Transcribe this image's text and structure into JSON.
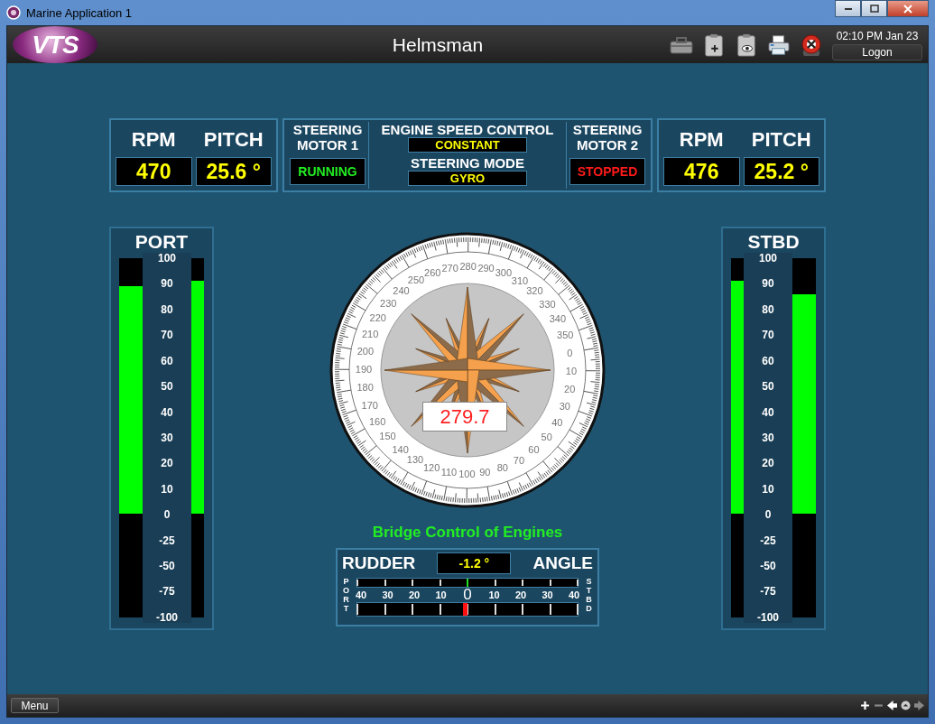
{
  "window": {
    "title": "Marine Application 1"
  },
  "header": {
    "logo": "VTS",
    "title": "Helmsman",
    "clock": "02:10 PM Jan 23",
    "logon_button": "Logon"
  },
  "top_panel": {
    "port_engine": {
      "rpm_label": "RPM",
      "pitch_label": "PITCH",
      "rpm": "470",
      "pitch": "25.6 °"
    },
    "steering_motors": [
      {
        "label": "STEERING MOTOR 1",
        "status": "RUNNING",
        "running": true
      },
      {
        "label": "STEERING MOTOR 2",
        "status": "STOPPED",
        "running": false
      }
    ],
    "engine_speed_control": {
      "label": "ENGINE SPEED CONTROL",
      "value": "CONSTANT"
    },
    "steering_mode": {
      "label": "STEERING MODE",
      "value": "GYRO"
    },
    "stbd_engine": {
      "rpm_label": "RPM",
      "pitch_label": "PITCH",
      "rpm": "476",
      "pitch": "25.2 °"
    }
  },
  "gauges": [
    {
      "title": "PORT",
      "bars": [
        {
          "kind": "wide",
          "level": 0.89
        },
        {
          "kind": "narrow",
          "level": 0.91
        }
      ],
      "scale": [
        "100",
        "90",
        "80",
        "70",
        "60",
        "50",
        "40",
        "30",
        "20",
        "10",
        "0",
        "-25",
        "-50",
        "-75",
        "-100"
      ]
    },
    {
      "title": "STBD",
      "bars": [
        {
          "kind": "narrow",
          "level": 0.91
        },
        {
          "kind": "wide",
          "level": 0.86
        }
      ],
      "scale": [
        "100",
        "90",
        "80",
        "70",
        "60",
        "50",
        "40",
        "30",
        "20",
        "10",
        "0",
        "-25",
        "-50",
        "-75",
        "-100"
      ]
    }
  ],
  "compass": {
    "reading": "279.7",
    "labels": [
      "270",
      "280",
      "290",
      "260",
      "300",
      "250",
      "310",
      "240",
      "320",
      "230",
      "330",
      "220",
      "340",
      "210",
      "350",
      "200",
      "0",
      "190",
      "10",
      "180",
      "20",
      "170",
      "30",
      "160",
      "40",
      "150",
      "50",
      "140",
      "60",
      "130",
      "70",
      "120",
      "80",
      "110",
      "100",
      "90"
    ]
  },
  "bridge_control": "Bridge Control of Engines",
  "rudder": {
    "label_left": "RUDDER",
    "reading": "-1.2 °",
    "label_right": "ANGLE",
    "port_label": "PORT",
    "stbd_label": "STBD",
    "scale": [
      "40",
      "30",
      "20",
      "10",
      "0",
      "10",
      "20",
      "30",
      "40"
    ],
    "command": {
      "level": 0.5
    },
    "actual": {
      "level": 0.487
    }
  },
  "footer": {
    "menu_button": "Menu"
  }
}
